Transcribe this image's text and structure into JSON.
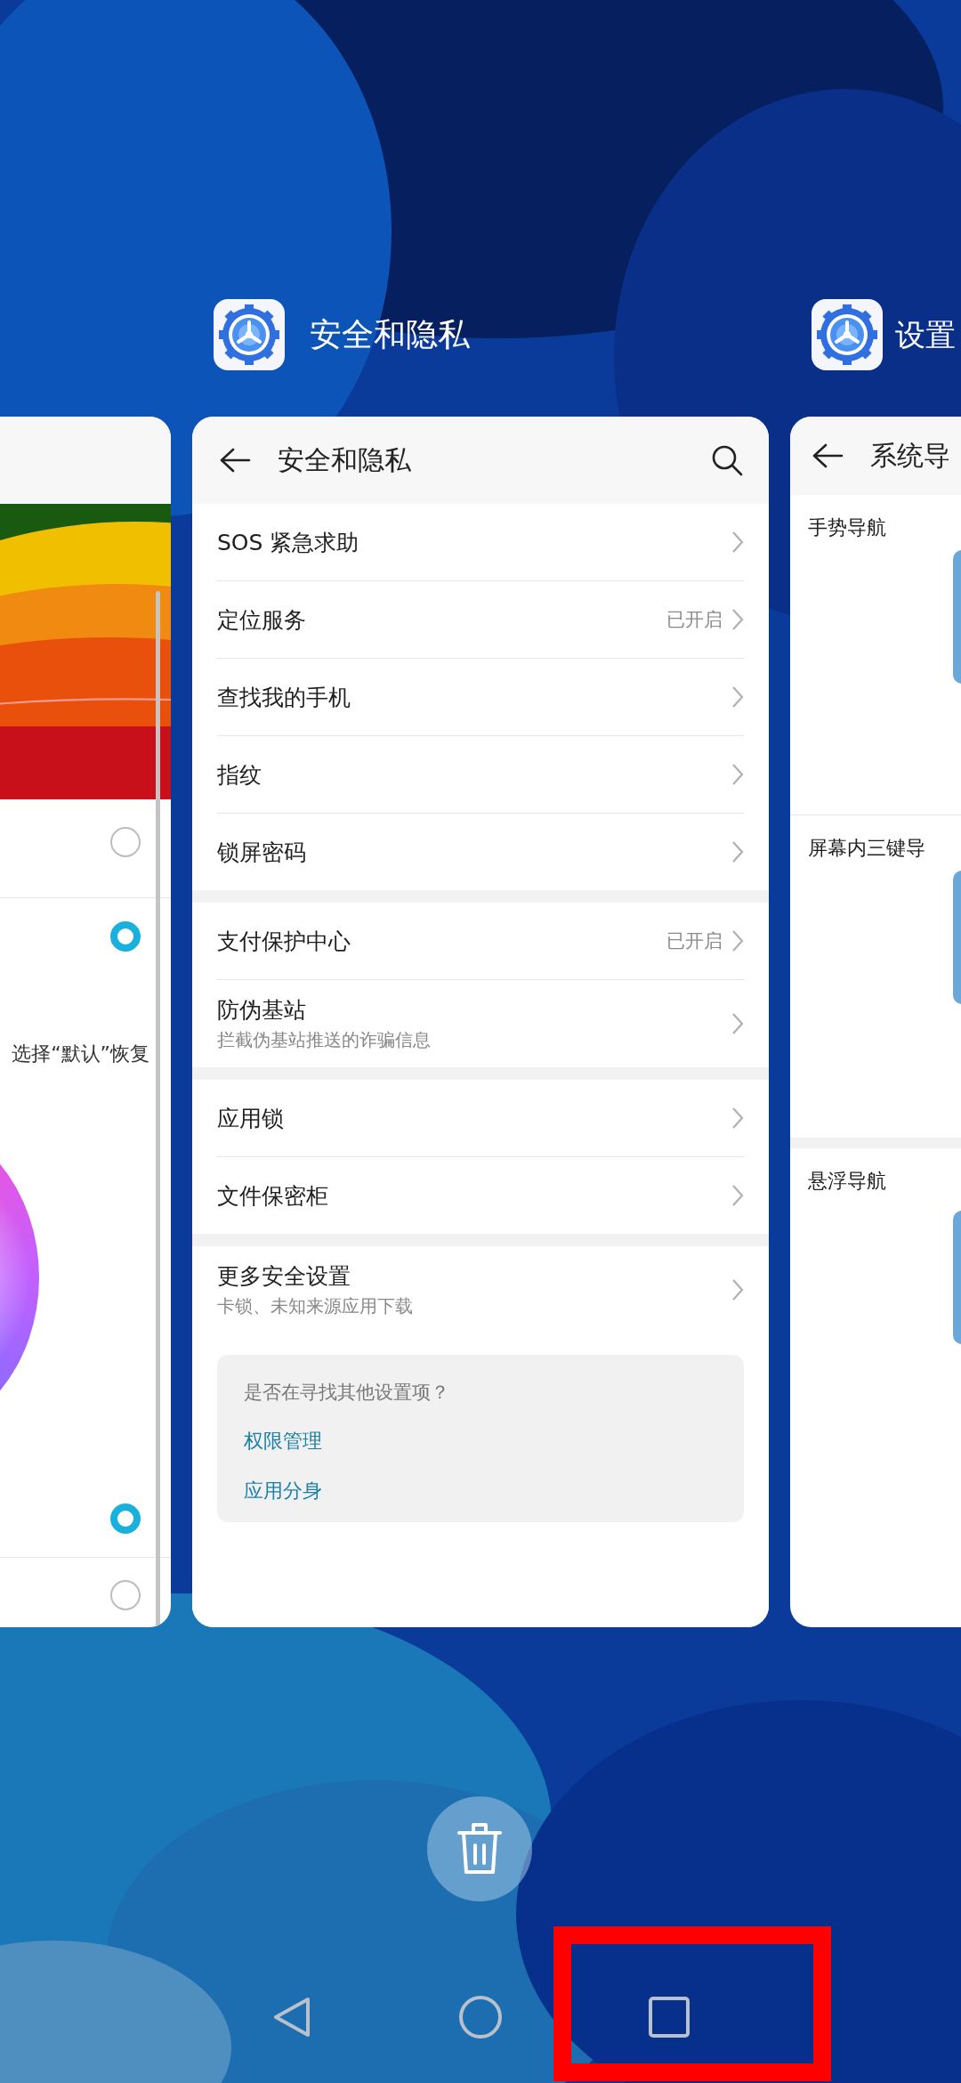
{
  "left_app": {
    "hint_text": "选择“默认”恢复",
    "options": [
      {
        "selected": false
      },
      {
        "selected": true
      },
      {
        "selected": true
      },
      {
        "selected": false
      }
    ]
  },
  "center_app": {
    "app_label": "安全和隐私",
    "title": "安全和隐私",
    "groups": [
      [
        {
          "label": "SOS 紧急求助"
        },
        {
          "label": "定位服务",
          "value": "已开启"
        },
        {
          "label": "查找我的手机"
        },
        {
          "label": "指纹"
        },
        {
          "label": "锁屏密码"
        }
      ],
      [
        {
          "label": "支付保护中心",
          "value": "已开启"
        },
        {
          "label": "防伪基站",
          "subtitle": "拦截伪基站推送的诈骗信息"
        }
      ],
      [
        {
          "label": "应用锁"
        },
        {
          "label": "文件保密柜"
        }
      ],
      [
        {
          "label": "更多安全设置",
          "subtitle": "卡锁、未知来源应用下载"
        }
      ]
    ],
    "suggestion": {
      "question": "是否在寻找其他设置项？",
      "links": [
        "权限管理",
        "应用分身"
      ]
    }
  },
  "right_app": {
    "app_label": "设置",
    "title": "系统导",
    "sections": [
      "手势导航",
      "屏幕内三键导",
      "悬浮导航"
    ]
  },
  "nav_bar": {
    "recents_highlighted": true
  }
}
